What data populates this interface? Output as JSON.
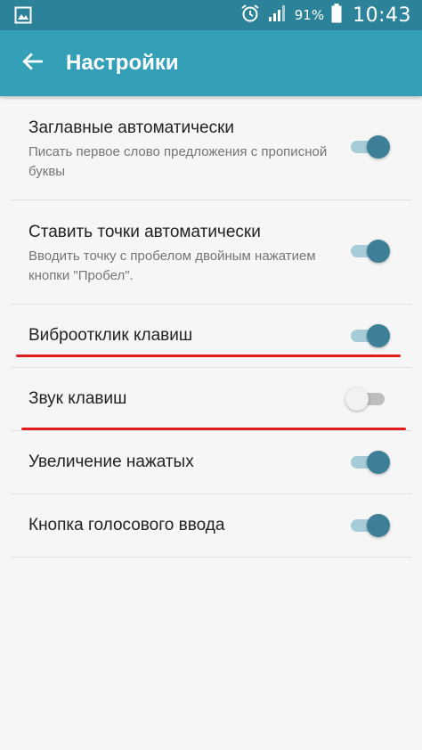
{
  "status_bar": {
    "icons": [
      "gallery-icon",
      "alarm-icon",
      "signal-icon",
      "battery-icon"
    ],
    "battery_percent": "91%",
    "time": "10:43"
  },
  "app_bar": {
    "back_icon": "arrow-left-icon",
    "title": "Настройки",
    "color": "#33a0b8"
  },
  "settings": [
    {
      "title": "Заглавные автоматически",
      "summary": "Писать первое слово предложения с прописной буквы",
      "enabled": true
    },
    {
      "title": "Ставить точки автоматически",
      "summary": "Вводить точку с пробелом двойным нажатием кнопки \"Пробел\".",
      "enabled": true
    },
    {
      "title": "Виброотклик клавиш",
      "summary": "",
      "enabled": true
    },
    {
      "title": "Звук клавиш",
      "summary": "",
      "enabled": false
    },
    {
      "title": "Увеличение нажатых",
      "summary": "",
      "enabled": true
    },
    {
      "title": "Кнопка голосового ввода",
      "summary": "",
      "enabled": true
    }
  ],
  "colors": {
    "switch_on_thumb": "#3d7f97",
    "switch_on_track": "#a6ccd7",
    "annotation": "#e01b1b"
  }
}
